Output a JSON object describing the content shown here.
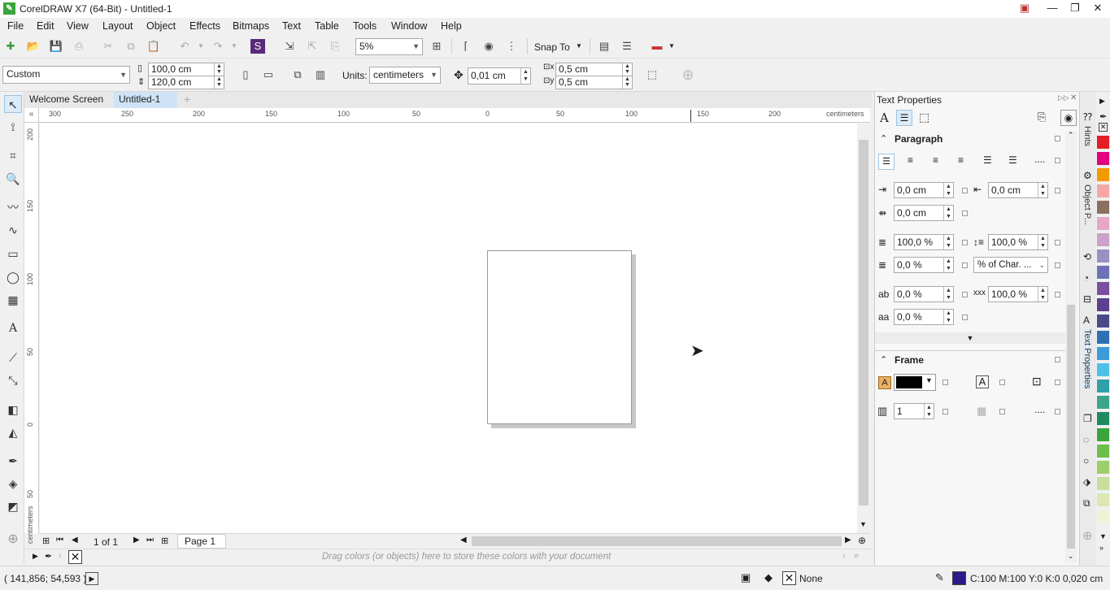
{
  "window": {
    "title": "CorelDRAW X7 (64-Bit) - Untitled-1",
    "minimize": "—",
    "restore": "❐",
    "close": "✕"
  },
  "menu": [
    "File",
    "Edit",
    "View",
    "Layout",
    "Object",
    "Effects",
    "Bitmaps",
    "Text",
    "Table",
    "Tools",
    "Window",
    "Help"
  ],
  "toolbar": {
    "zoom": "5%",
    "snap_to": "Snap To"
  },
  "propbar": {
    "page_size": "Custom",
    "width": "100,0 cm",
    "height": "120,0 cm",
    "units_label": "Units:",
    "units": "centimeters",
    "nudge": "0,01 cm",
    "dup_x": "0,5 cm",
    "dup_y": "0,5 cm"
  },
  "doctabs": [
    "Welcome Screen",
    "Untitled-1"
  ],
  "hruler": {
    "labels": [
      "300",
      "250",
      "200",
      "150",
      "100",
      "50",
      "0",
      "50",
      "100",
      "150",
      "200"
    ],
    "unit": "centimeters"
  },
  "vruler": {
    "labels": [
      "200",
      "150",
      "100",
      "50",
      "0",
      "50"
    ],
    "unit": "centimeters"
  },
  "pagenav": {
    "count": "1 of 1",
    "tab": "Page 1"
  },
  "palette_hint": "Drag colors (or objects) here to store these colors with your document",
  "panel": {
    "title": "Text Properties",
    "paragraph": {
      "title": "Paragraph",
      "left_indent": "0,0 cm",
      "right_indent": "0,0 cm",
      "first_line": "0,0 cm",
      "para_spacing": "100,0 %",
      "line_spacing": "100,0 %",
      "before": "0,0 %",
      "spacing_unit": "% of Char. ...",
      "char_spacing": "0,0 %",
      "word_spacing": "100,0 %",
      "lang_spacing": "0,0 %",
      "more": "...."
    },
    "frame": {
      "title": "Frame",
      "columns": "1",
      "more": "...."
    }
  },
  "sidetabs": [
    "Hints",
    "Object P...",
    "Text Properties"
  ],
  "palette_colors": [
    "#e31e24",
    "#e4007f",
    "#f39800",
    "#f5a7a8",
    "#8b6f5f",
    "#e6a6c9",
    "#c8a2c8",
    "#9b8fc7",
    "#6b72b8",
    "#7a4fa0",
    "#5c3f8e",
    "#4a4a8a",
    "#2f6fb5",
    "#3c9bd7",
    "#4fc1e9",
    "#2f9fa8",
    "#3aa58a",
    "#1e8a5f",
    "#3aa53a",
    "#6cbf4a",
    "#9ccf6a",
    "#c6df9a",
    "#dbe8b6",
    "#eef3d6"
  ],
  "status": {
    "coords": "( 141,856; 54,593 )",
    "fill": "None",
    "outline": "C:100 M:100 Y:0 K:0  0,020 cm",
    "outline_color": "#2a1a8a"
  }
}
